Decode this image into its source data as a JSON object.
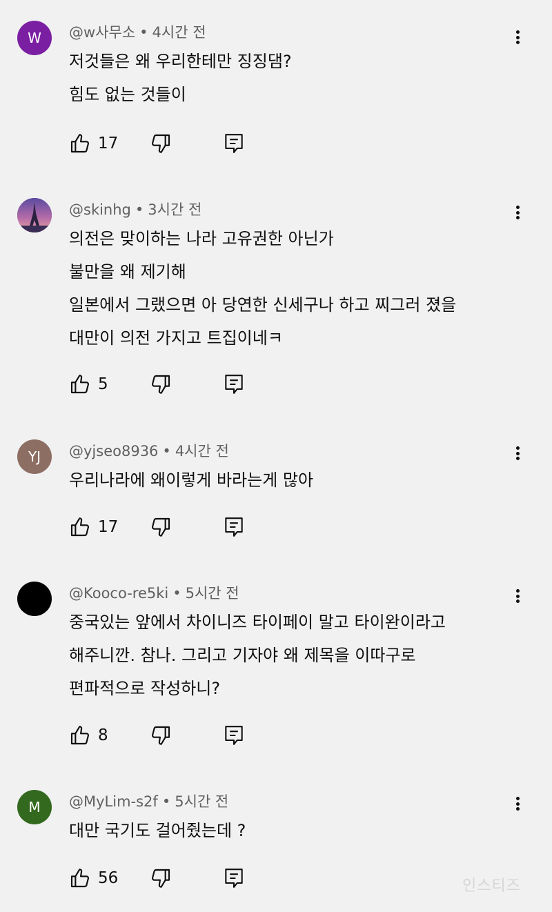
{
  "comments": [
    {
      "author": "@w사무소",
      "time": "4시간 전",
      "avatar_letter": "W",
      "avatar_color": "#7b1fa2",
      "lines": [
        "저것들은 왜 우리한테만 징징댐?",
        "힘도 없는 것들이"
      ],
      "likes": "17"
    },
    {
      "author": "@skinhg",
      "time": "3시간 전",
      "avatar_letter": "",
      "avatar_color": "#6a4f9a",
      "lines": [
        "의전은 맞이하는 나라 고유권한 아닌가",
        "불만을 왜 제기해",
        "일본에서 그랬으면 아 당연한 신세구나 하고 찌그러 졌을",
        "대만이 의전 가지고 트집이네ㅋ"
      ],
      "likes": "5"
    },
    {
      "author": "@yjseo8936",
      "time": "4시간 전",
      "avatar_letter": "YJ",
      "avatar_color": "#8d6e63",
      "lines": [
        "우리나라에 왜이렇게 바라는게 많아"
      ],
      "likes": "17"
    },
    {
      "author": "@Kooco-re5ki",
      "time": "5시간 전",
      "avatar_letter": "",
      "avatar_color": "#000000",
      "lines": [
        "중국있는 앞에서 차이니즈 타이페이 말고 타이완이라고",
        "해주니깐. 참나. 그리고 기자야 왜 제목을 이따구로",
        "편파적으로 작성하니?"
      ],
      "likes": "8"
    },
    {
      "author": "@MyLim-s2f",
      "time": "5시간 전",
      "avatar_letter": "M",
      "avatar_color": "#33691e",
      "lines": [
        "대만 국기도 걸어줬는데 ?"
      ],
      "likes": "56"
    }
  ],
  "separator": "•",
  "icons": {
    "like": "thumbs-up-icon",
    "dislike": "thumbs-down-icon",
    "reply": "reply-icon",
    "more": "more-vert-icon"
  },
  "watermark": "인스티즈"
}
